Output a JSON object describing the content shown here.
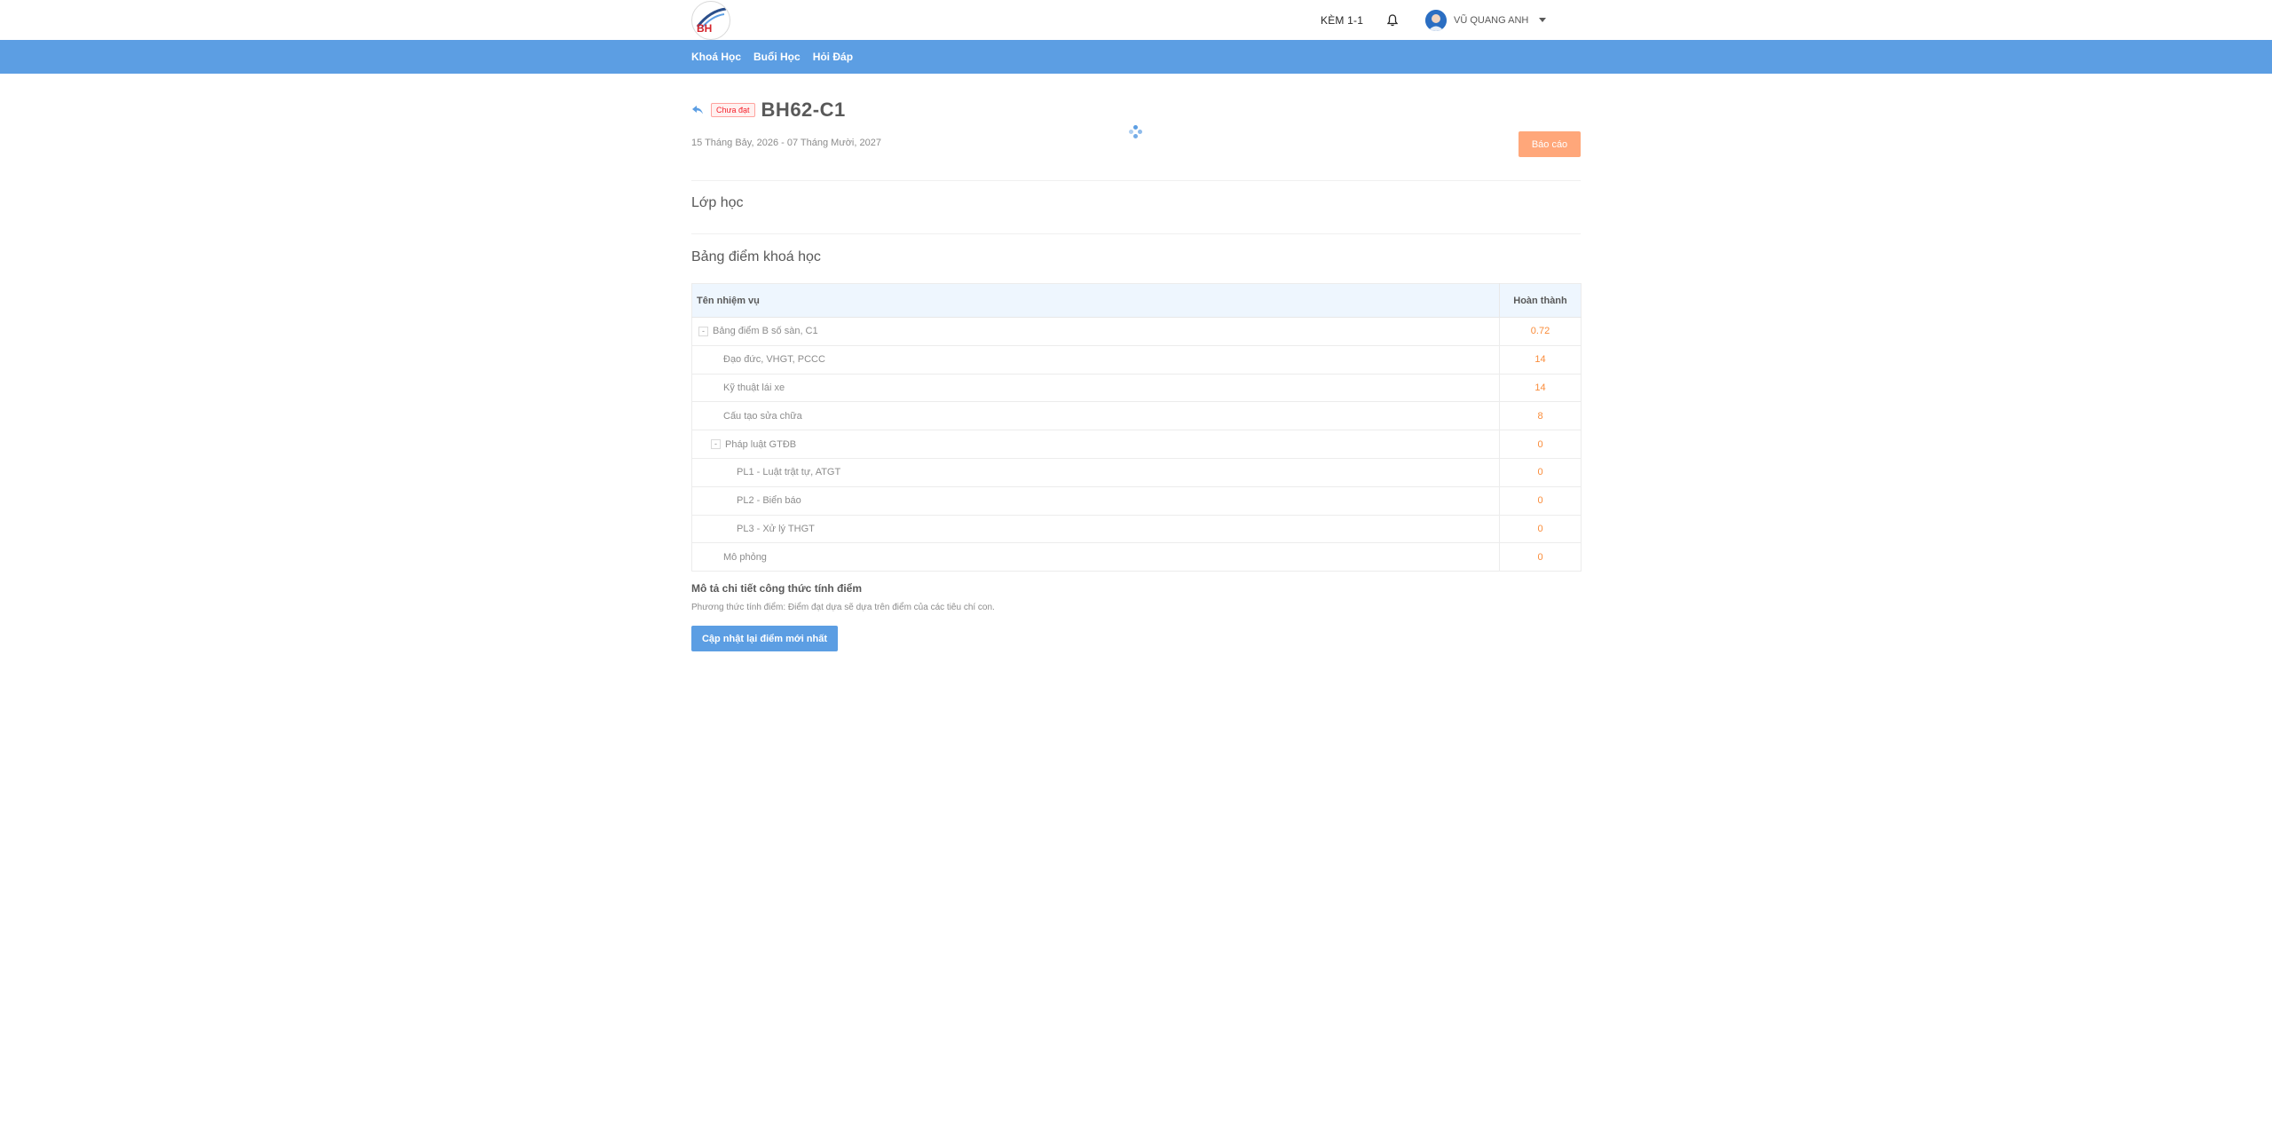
{
  "header": {
    "course_link": "KÈM 1-1",
    "user_name": "VŨ QUANG ANH",
    "logo_text": "BH"
  },
  "nav": {
    "items": [
      {
        "label": "Khoá Học"
      },
      {
        "label": "Buổi Học"
      },
      {
        "label": "Hỏi Đáp"
      }
    ]
  },
  "course": {
    "status_tag": "Chưa đạt",
    "title": "BH62-C1",
    "date_range": "15 Tháng Bảy, 2026 - 07 Tháng Mười, 2027",
    "report_button": "Báo cáo"
  },
  "sections": {
    "class_title": "Lớp học",
    "scores_title": "Bảng điểm khoá học"
  },
  "table": {
    "headers": {
      "task": "Tên nhiệm vụ",
      "done": "Hoàn thành"
    },
    "rows": [
      {
        "label": "Bảng điểm B số sàn, C1",
        "value": "0.72",
        "level": 0,
        "expander": "-"
      },
      {
        "label": "Đạo đức, VHGT, PCCC",
        "value": "14",
        "level": 1
      },
      {
        "label": "Kỹ thuật lái xe",
        "value": "14",
        "level": 1
      },
      {
        "label": "Cấu tạo sửa chữa",
        "value": "8",
        "level": 1
      },
      {
        "label": "Pháp luật GTĐB",
        "value": "0",
        "level": 1,
        "expander": "-"
      },
      {
        "label": "PL1 - Luật trật tự, ATGT",
        "value": "0",
        "level": 2
      },
      {
        "label": "PL2 - Biển báo",
        "value": "0",
        "level": 2
      },
      {
        "label": "PL3 - Xử lý THGT",
        "value": "0",
        "level": 2
      },
      {
        "label": "Mô phỏng",
        "value": "0",
        "level": 1
      }
    ]
  },
  "formula": {
    "title": "Mô tả chi tiết công thức tính điểm",
    "description": "Phương thức tính điểm: Điểm đạt dựa sẽ dựa trên điểm của các tiêu chí con.",
    "update_button": "Cập nhật lại điểm mới nhất"
  },
  "colors": {
    "nav_bar": "#5c9ee3",
    "report_button": "#ffa77a",
    "value_text": "#fa8c3a",
    "status_red": "#f5222d"
  }
}
